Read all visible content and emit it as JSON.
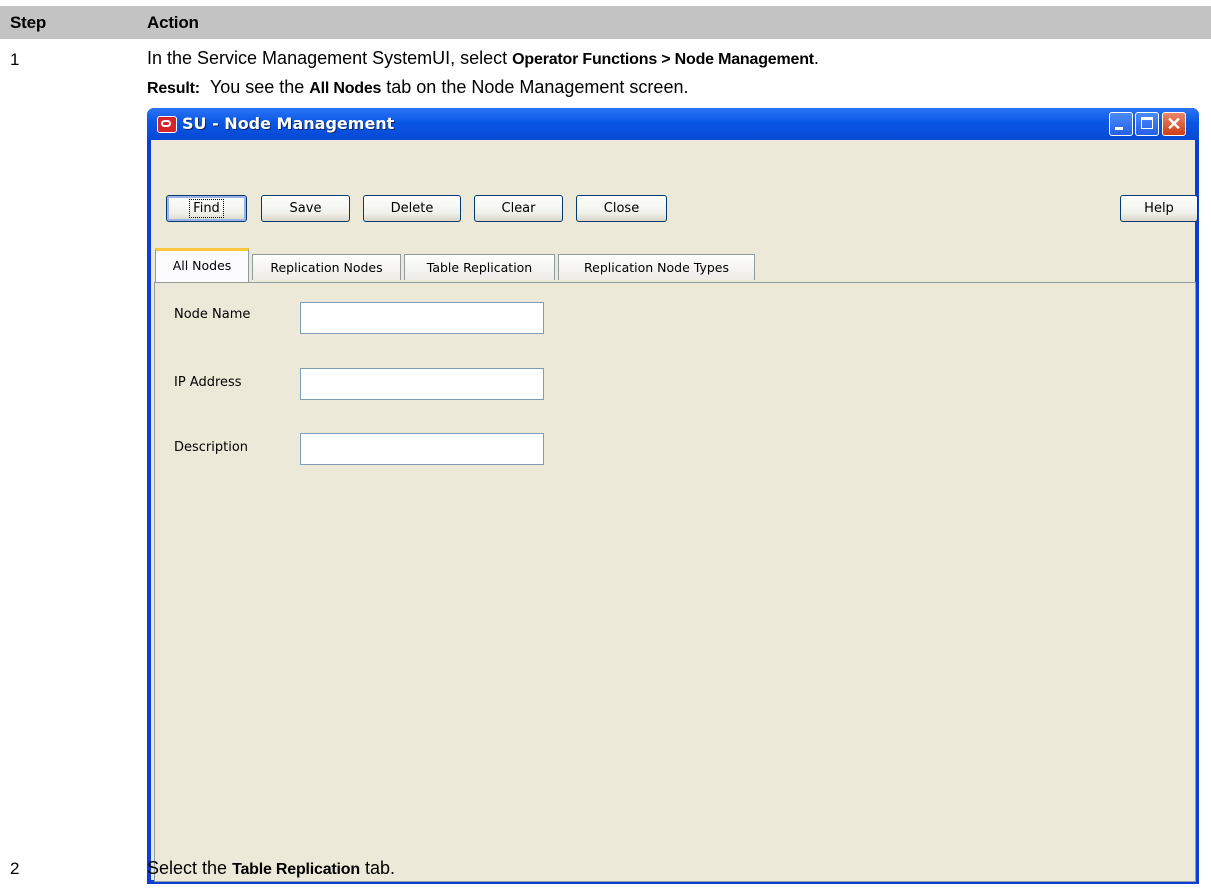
{
  "doc": {
    "col_step": "Step",
    "col_action": "Action",
    "step1_num": "1",
    "step1_text_a": "In the Service Management SystemUI, select ",
    "step1_cond": "Operator Functions > Node Management",
    "step1_text_b": ".",
    "result_label": "Result:",
    "result_text_a": "You see the ",
    "result_cond": "All Nodes",
    "result_text_b": " tab on the Node Management screen.",
    "step2_num": "2",
    "step2_text_a": "Select the ",
    "step2_cond": "Table Replication",
    "step2_text_b": " tab."
  },
  "window": {
    "title": "SU - Node Management",
    "close_glyph": "✕"
  },
  "toolbar": {
    "find": "Find",
    "save": "Save",
    "delete": "Delete",
    "clear": "Clear",
    "close": "Close",
    "help": "Help"
  },
  "tabs": [
    {
      "label": "All Nodes",
      "active": true
    },
    {
      "label": "Replication Nodes",
      "active": false
    },
    {
      "label": "Table Replication",
      "active": false
    },
    {
      "label": "Replication Node Types",
      "active": false
    }
  ],
  "form": {
    "node_name_label": "Node Name",
    "node_name_value": "",
    "ip_address_label": "IP Address",
    "ip_address_value": "",
    "description_label": "Description",
    "description_value": ""
  },
  "colors": {
    "titlebar": "#0a57e5",
    "client_bg": "#ece9d8",
    "active_tab_accent": "#ffc83c",
    "doc_header_bg": "#c3c3c3"
  }
}
